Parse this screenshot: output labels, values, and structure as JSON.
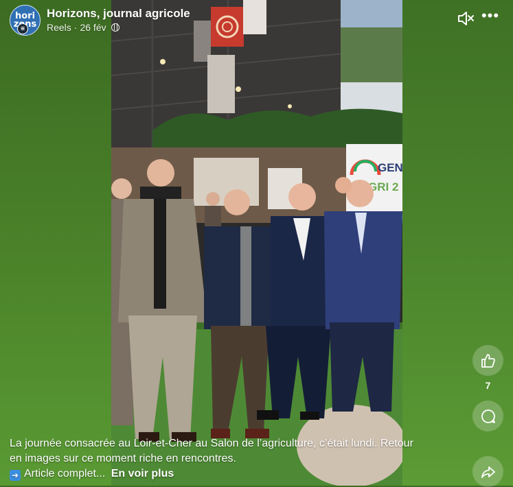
{
  "post": {
    "page_name": "Horizons, journal agricole",
    "type": "Reels",
    "separator": "·",
    "date": "26 fév",
    "avatar_text": "hori\nzons",
    "caption_line1": "La journée consacrée au Loir-et-Cher au Salon de l’agriculture, c’était lundi. Retour",
    "caption_line2": "en images sur ce moment riche en rencontres.",
    "caption_line3": "Article complet...",
    "see_more": "En voir plus"
  },
  "actions": {
    "like_count": "7",
    "more_glyph": "•••"
  },
  "video_sign": {
    "text_line1": "GEND",
    "text_line2": "GRI 2"
  },
  "icons": [
    "globe-icon",
    "mute-icon",
    "more-icon",
    "like-icon",
    "comment-icon",
    "share-icon",
    "arrow-right-icon"
  ],
  "colors": {
    "background_green": "#4f8a2c",
    "avatar_blue": "#2f6fb4",
    "button_bg": "rgba(255,255,255,0.22)"
  }
}
